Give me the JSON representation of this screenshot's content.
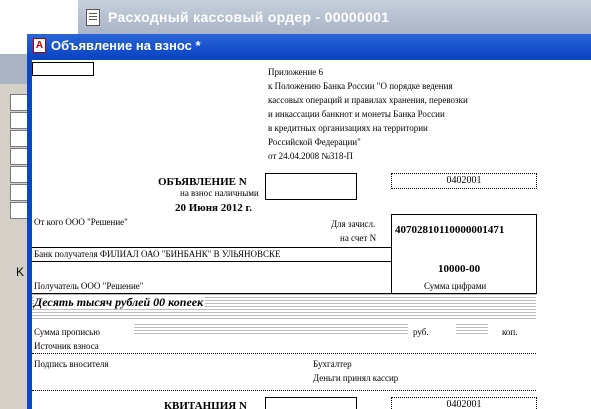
{
  "back_window": {
    "title": "Расходный кассовый ордер - 00000001"
  },
  "front_window": {
    "title": "Объявление на взнос  *"
  },
  "left_window": {
    "partial_text": "K"
  },
  "form": {
    "appendix": [
      "Приложение 6",
      "к Положению Банка России \"О порядке ведения",
      "кассовых операций и правилах хранения, перевозки",
      "и инкассации банкнот и монеты Банка России",
      "в кредитных организациях на территории",
      "Российской Федерации\"",
      "от 24.04.2008 №318-П"
    ],
    "heading": "ОБЪЯВЛЕНИЕ N",
    "subheading": "на взнос наличными",
    "date": "20 Июня 2012 г.",
    "okud": "0402001",
    "from_label": "От кого ООО \"Решение\"",
    "account_label_1": "Для зачисл.",
    "account_label_2": "на счет N",
    "account_number": "40702810110000001471",
    "bank_label": "Банк получателя ФИЛИАЛ ОАО \"БИНБАНК\" В УЛЬЯНОВСКЕ",
    "amount_digits": "10000-00",
    "recipient_label": "Получатель ООО \"Решение\"",
    "amount_digits_label": "Сумма цифрами",
    "amount_words": "Десять тысяч рублей 00 копеек",
    "amount_words_label": "Сумма прописью",
    "rub_label": "руб.",
    "kop_label": "коп.",
    "source_label": "Источник взноса",
    "payer_signature": "Подпись вносителя",
    "accountant": "Бухгалтер",
    "cashier": "Деньги принял кассир",
    "receipt_heading": "КВИТАНЦИЯ N",
    "receipt_okud": "0402001"
  }
}
